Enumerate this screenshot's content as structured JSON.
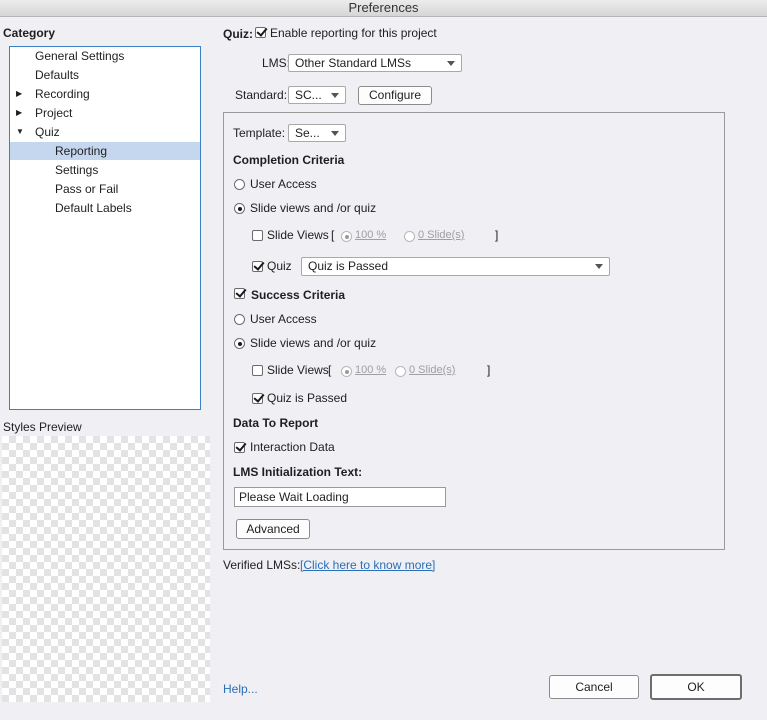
{
  "window": {
    "title": "Preferences"
  },
  "sidebar": {
    "heading": "Category",
    "items": [
      {
        "label": "General Settings"
      },
      {
        "label": "Defaults"
      },
      {
        "label": "Recording"
      },
      {
        "label": "Project"
      },
      {
        "label": "Quiz"
      },
      {
        "label": "Reporting"
      },
      {
        "label": "Settings"
      },
      {
        "label": "Pass or Fail"
      },
      {
        "label": "Default Labels"
      }
    ],
    "selected": "Reporting",
    "styles_preview_label": "Styles Preview"
  },
  "quiz": {
    "label": "Quiz:",
    "enable_reporting_label": "Enable reporting for this project",
    "enable_reporting_checked": true,
    "lms_label": "LMS:",
    "lms_value": "Other Standard LMSs",
    "standard_label": "Standard:",
    "standard_value": "SC...",
    "configure_label": "Configure"
  },
  "panel": {
    "template_label": "Template:",
    "template_value": "Se...",
    "completion": {
      "heading": "Completion Criteria",
      "user_access_label": "User Access",
      "slide_views_quiz_label": "Slide views and /or quiz",
      "selected": "slide_views_quiz",
      "slide_views_label": "Slide Views",
      "slide_views_checked": false,
      "open_bracket": "[",
      "percent_value": "100 %",
      "slides_value": "0 Slide(s)",
      "close_bracket": "]",
      "quiz_label": "Quiz",
      "quiz_checked": true,
      "quiz_dropdown_value": "Quiz is Passed"
    },
    "success": {
      "heading": "Success Criteria",
      "heading_checked": true,
      "user_access_label": "User Access",
      "slide_views_quiz_label": "Slide views and /or quiz",
      "selected": "slide_views_quiz",
      "slide_views_label": "Slide Views",
      "slide_views_checked": false,
      "open_bracket": "[",
      "percent_value": "100 %",
      "slides_value": "0 Slide(s)",
      "close_bracket": "]",
      "quiz_passed_label": "Quiz is Passed",
      "quiz_passed_checked": true
    },
    "data_to_report": {
      "heading": "Data To Report",
      "interaction_data_label": "Interaction Data",
      "interaction_data_checked": true
    },
    "lms_init": {
      "heading": "LMS Initialization Text:",
      "value": "Please Wait Loading"
    },
    "advanced_label": "Advanced"
  },
  "footer": {
    "verified_label": "Verified LMSs:",
    "verified_link": "[Click here to know more]",
    "help_link": "Help...",
    "cancel_label": "Cancel",
    "ok_label": "OK"
  },
  "colors": {
    "background": "#efeff4",
    "selection": "#c5d7ee",
    "focus_border": "#3a82c4",
    "link": "#2a6fb7"
  }
}
